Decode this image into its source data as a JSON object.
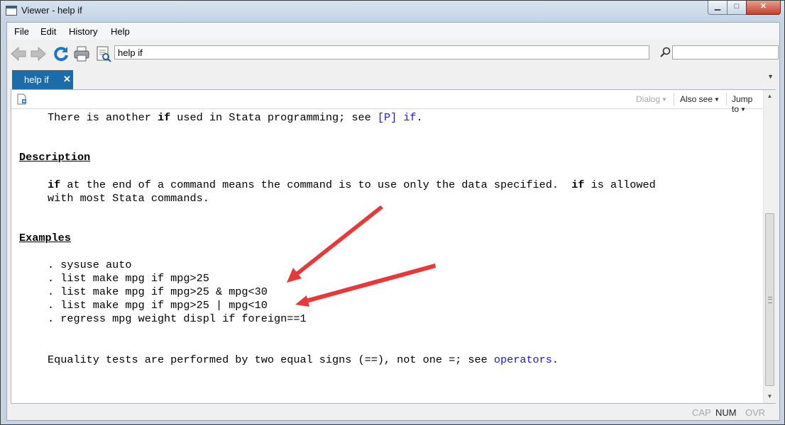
{
  "window": {
    "title": "Viewer - help if"
  },
  "menu": [
    "File",
    "Edit",
    "History",
    "Help"
  ],
  "toolbar": {
    "address_value": "help if",
    "find_value": ""
  },
  "tab": {
    "label": "help if",
    "close": "✕"
  },
  "viewer_bar": {
    "dialog_label": "Dialog",
    "also_see_label": "Also see",
    "jump_to_label": "Jump to"
  },
  "help": {
    "intro": {
      "pre": "There is another ",
      "kw": "if",
      "mid": " used in Stata programming; see ",
      "link1": "[P]",
      "space": " ",
      "link2": "if",
      "post": "."
    },
    "description_heading": "Description",
    "description": {
      "kw1": "if",
      "text1": " at the end of a command means the command is to use only the data specified.  ",
      "kw2": "if",
      "text2": " is allowed",
      "line2": "with most Stata commands."
    },
    "examples_heading": "Examples",
    "examples": [
      ". sysuse auto",
      ". list make mpg if mpg>25",
      ". list make mpg if mpg>25 & mpg<30",
      ". list make mpg if mpg>25 | mpg<10",
      ". regress mpg weight displ if foreign==1"
    ],
    "equality": {
      "pre": "Equality tests are performed by two equal signs (==), not one =; see ",
      "link": "operators",
      "post": "."
    }
  },
  "status": {
    "cap": "CAP",
    "num": "NUM",
    "ovr": "OVR"
  },
  "colors": {
    "tab_active": "#1b6ca8",
    "link": "#1a1ad6",
    "annotation_arrow": "#e8383a"
  }
}
